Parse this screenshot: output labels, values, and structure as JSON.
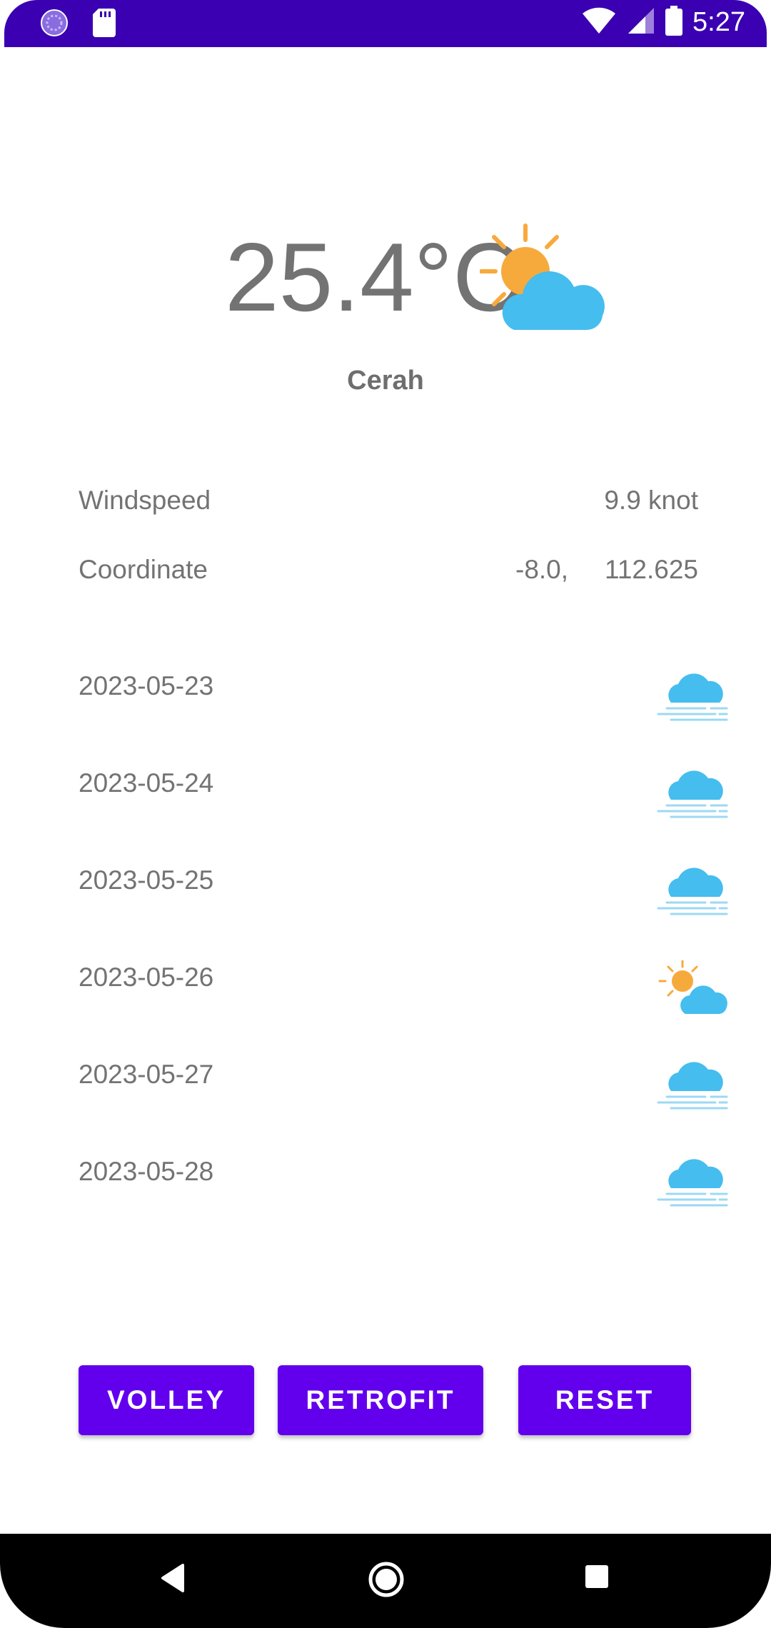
{
  "status_bar": {
    "time": "5:27",
    "left_icons": [
      "circle-app-icon",
      "sd-card-icon"
    ],
    "right_icons": [
      "wifi-icon",
      "cell-signal-icon",
      "battery-icon"
    ],
    "bar_color": "#3a00b2"
  },
  "current": {
    "temperature": "25.4°C",
    "condition_icon": "partly-cloudy-icon",
    "description": "Cerah"
  },
  "details": {
    "windspeed_label": "Windspeed",
    "windspeed_value": "9.9 knot",
    "coordinate_label": "Coordinate",
    "latitude": "-8.0,",
    "longitude": "112.625"
  },
  "forecast": [
    {
      "date": "2023-05-23",
      "icon": "fog-cloud-icon"
    },
    {
      "date": "2023-05-24",
      "icon": "fog-cloud-icon"
    },
    {
      "date": "2023-05-25",
      "icon": "fog-cloud-icon"
    },
    {
      "date": "2023-05-26",
      "icon": "partly-cloudy-icon"
    },
    {
      "date": "2023-05-27",
      "icon": "fog-cloud-icon"
    },
    {
      "date": "2023-05-28",
      "icon": "fog-cloud-icon"
    }
  ],
  "buttons": {
    "volley": "VOLLEY",
    "retrofit": "RETROFIT",
    "reset": "RESET"
  },
  "colors": {
    "accent": "#6200ee",
    "cloud": "#45bdef",
    "sun": "#f7aa3c",
    "text": "#737373"
  },
  "nav_bar": {
    "icons": [
      "back-icon",
      "home-icon",
      "recents-icon"
    ]
  }
}
